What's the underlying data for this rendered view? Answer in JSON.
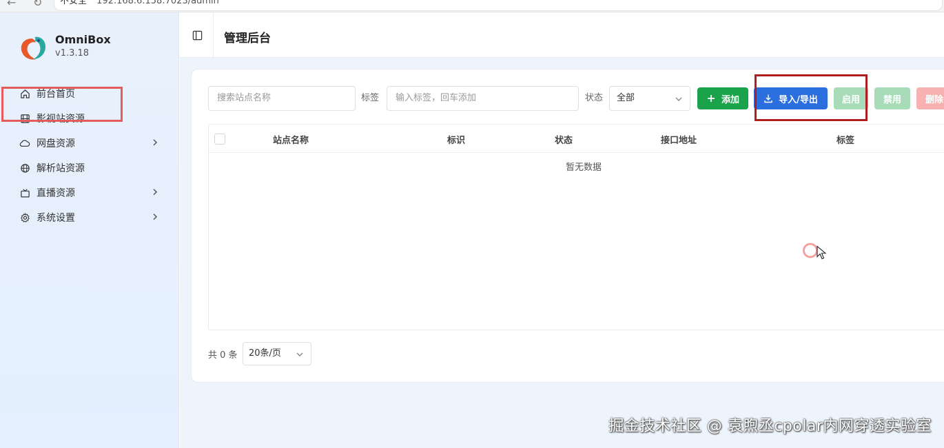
{
  "browser": {
    "warning": "不安全",
    "url": "192.168.6.158:7023/admin"
  },
  "brand": {
    "name": "OmniBox",
    "version": "v1.3.18"
  },
  "sidebar": {
    "items": [
      {
        "label": "前台首页",
        "icon": "home-icon",
        "has_submenu": false
      },
      {
        "label": "影视站资源",
        "icon": "film-icon",
        "has_submenu": false,
        "highlighted": true
      },
      {
        "label": "网盘资源",
        "icon": "cloud-icon",
        "has_submenu": true
      },
      {
        "label": "解析站资源",
        "icon": "globe-icon",
        "has_submenu": true
      },
      {
        "label": "直播资源",
        "icon": "tv-icon",
        "has_submenu": true
      },
      {
        "label": "系统设置",
        "icon": "gear-icon",
        "has_submenu": true
      }
    ]
  },
  "header": {
    "title": "管理后台"
  },
  "toolbar": {
    "search_placeholder": "搜索站点名称",
    "tag_label": "标签",
    "tag_placeholder": "输入标签，回车添加",
    "status_label": "状态",
    "status_value": "全部",
    "add_label": "添加",
    "io_label": "导入/导出",
    "enable_label": "启用",
    "disable_label": "禁用",
    "delete_label": "删除"
  },
  "table": {
    "columns": [
      "站点名称",
      "标识",
      "状态",
      "接口地址",
      "标签"
    ],
    "empty_text": "暂无数据"
  },
  "pagination": {
    "total": "共 0 条",
    "page_size": "20条/页"
  },
  "watermark": "掘金技术社区 @ 袁煦丞cpolar内网穿透实验室",
  "colors": {
    "add": "#1aa34a",
    "io": "#2b6fdf",
    "highlight": "#e35b5b"
  }
}
